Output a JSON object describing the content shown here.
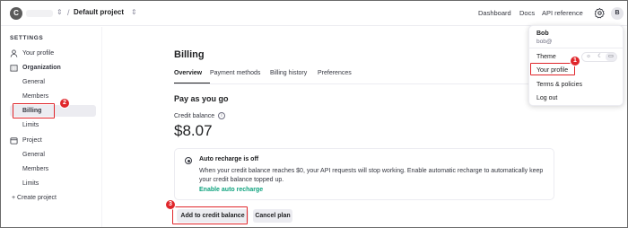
{
  "topbar": {
    "org_initial": "C",
    "project_name": "Default project",
    "links": [
      "Dashboard",
      "Docs",
      "API reference"
    ],
    "user_initial": "B"
  },
  "sidebar": {
    "heading": "SETTINGS",
    "your_profile": "Your profile",
    "organization": "Organization",
    "org_items": [
      "General",
      "Members",
      "Billing",
      "Limits"
    ],
    "project": "Project",
    "project_items": [
      "General",
      "Members",
      "Limits"
    ],
    "create_project": "+ Create project",
    "active_item": "Billing"
  },
  "main": {
    "title": "Billing",
    "tabs": [
      "Overview",
      "Payment methods",
      "Billing history",
      "Preferences"
    ],
    "active_tab": "Overview",
    "section_title": "Pay as you go",
    "credit_label": "Credit balance",
    "credit_amount": "$8.07",
    "recharge": {
      "title": "Auto recharge is off",
      "description": "When your credit balance reaches $0, your API requests will stop working. Enable automatic recharge to automatically keep your credit balance topped up.",
      "link": "Enable auto recharge"
    },
    "buttons": {
      "add_credit": "Add to credit balance",
      "cancel_plan": "Cancel plan"
    }
  },
  "dropdown": {
    "name": "Bob",
    "email": "bob@",
    "theme_label": "Theme",
    "theme_options": [
      "sun-icon",
      "moon-icon",
      "monitor-icon"
    ],
    "theme_selected": "monitor-icon",
    "items": [
      "Your profile",
      "Terms & policies",
      "Log out"
    ]
  },
  "annotations": {
    "badge_1": "1",
    "badge_2": "2",
    "badge_3": "3",
    "color": "#e0262b"
  },
  "colors": {
    "accent_green": "#10a37f",
    "active_bg": "#ececf1"
  }
}
